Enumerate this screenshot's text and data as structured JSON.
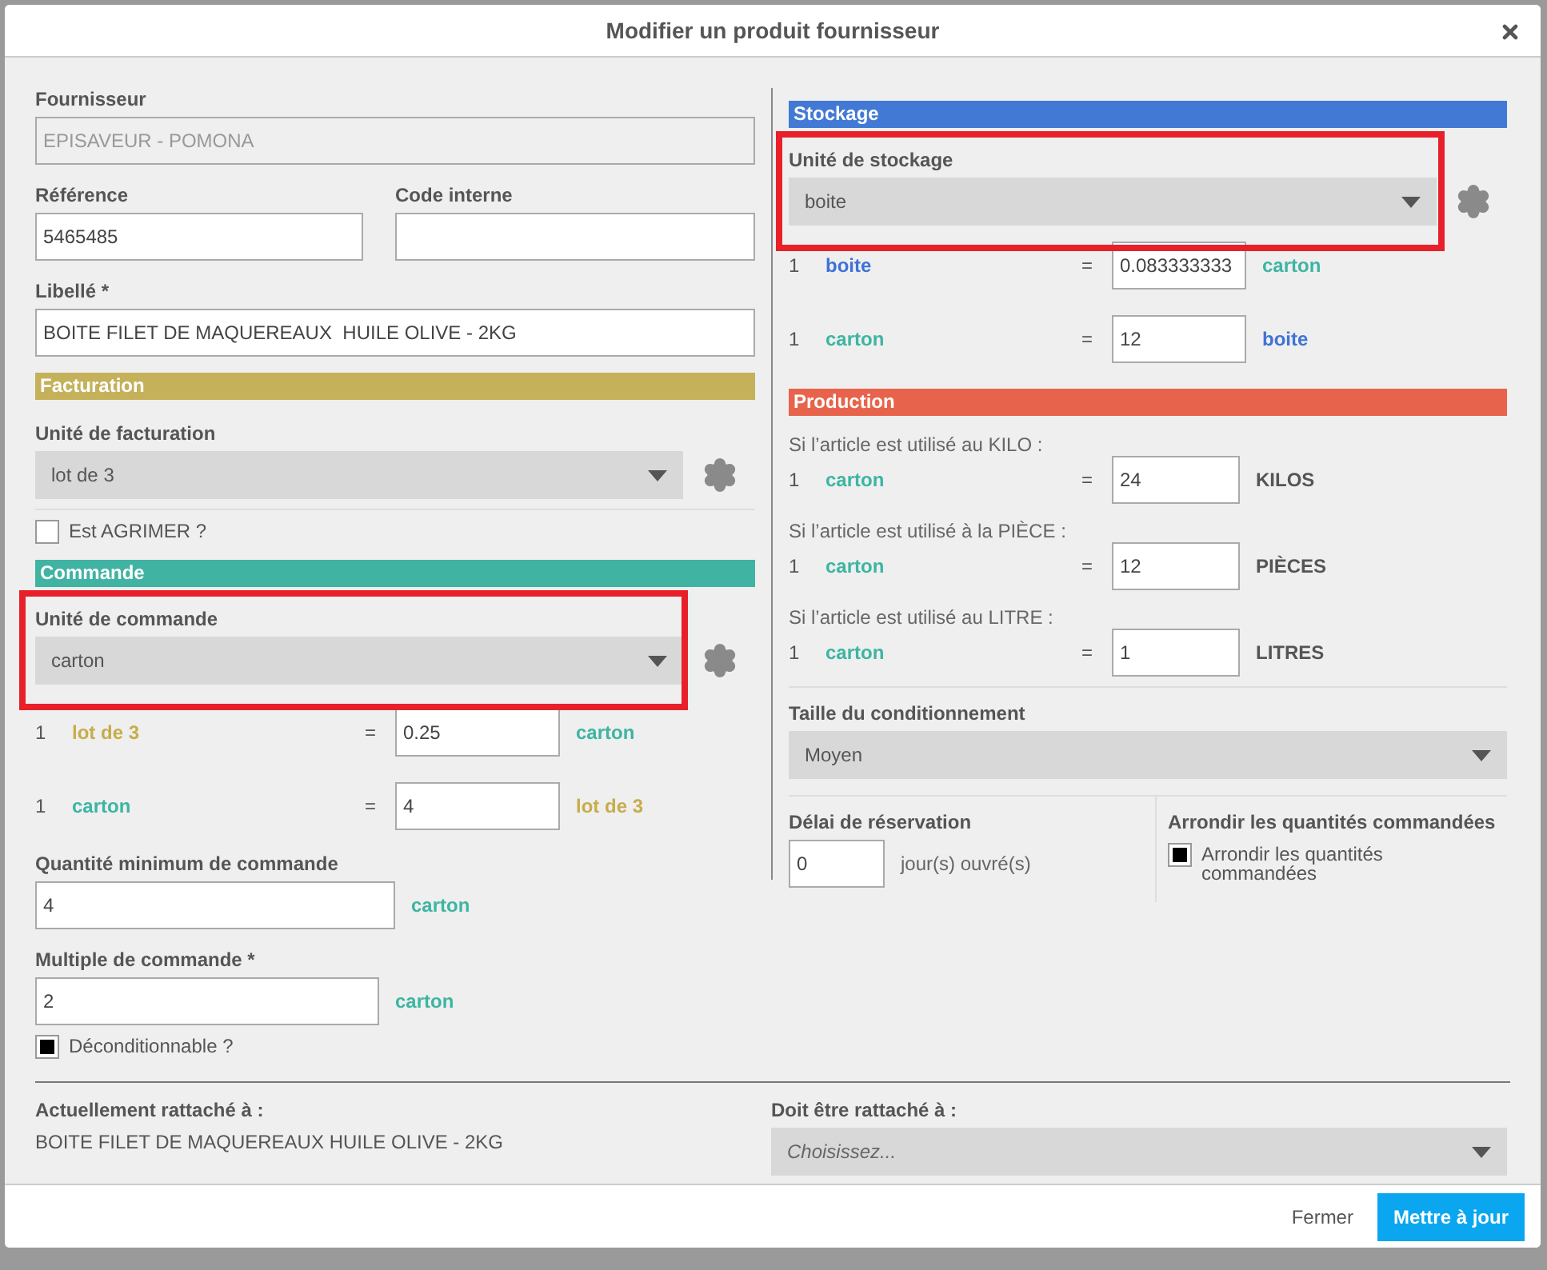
{
  "dialog": {
    "title": "Modifier un produit fournisseur"
  },
  "left": {
    "supplier": {
      "label": "Fournisseur",
      "value": "EPISAVEUR - POMONA",
      "disabled": true
    },
    "reference": {
      "label": "Référence",
      "value": "5465485"
    },
    "internal_code": {
      "label": "Code interne"
    },
    "product_label": {
      "label": "Libellé *",
      "value": "BOITE FILET DE MAQUEREAUX  HUILE OLIVE - 2KG"
    },
    "billing": {
      "heading": "Facturation",
      "color": "#c4b15a",
      "unit_label": "Unité de facturation",
      "unit_value": "lot de 3",
      "agrimer": {
        "label": "Est AGRIMER ?",
        "checked": false
      }
    },
    "order": {
      "heading": "Commande",
      "color": "#41b3a3",
      "unit_label": "Unité de commande",
      "unit_value": "carton",
      "highlighted": true,
      "conversions": [
        {
          "qty": "1",
          "unit": {
            "label": "lot de 3",
            "kind": "billing"
          },
          "eq": "=",
          "value": "0.25",
          "target": {
            "label": "carton",
            "kind": "order"
          }
        },
        {
          "qty": "1",
          "unit": {
            "label": "carton",
            "kind": "order"
          },
          "eq": "=",
          "value": "4",
          "target": {
            "label": "lot de 3",
            "kind": "billing"
          }
        }
      ],
      "min_qty": {
        "label": "Quantité minimum de commande",
        "value": "4",
        "unit": "carton"
      },
      "multiple": {
        "label": "Multiple de commande *",
        "value": "2",
        "unit": "carton"
      },
      "deconditionnable": {
        "label": "Déconditionnable ?",
        "checked": true
      }
    }
  },
  "right": {
    "storage": {
      "heading": "Stockage",
      "color": "#4279d5",
      "unit_label": "Unité de stockage",
      "unit_value": "boite",
      "highlighted": true,
      "conversions": [
        {
          "qty": "1",
          "unit": {
            "label": "boite",
            "kind": "storage"
          },
          "eq": "=",
          "value": "0.083333333",
          "target": {
            "label": "carton",
            "kind": "order"
          }
        },
        {
          "qty": "1",
          "unit": {
            "label": "carton",
            "kind": "order"
          },
          "eq": "=",
          "value": "12",
          "target": {
            "label": "boite",
            "kind": "storage"
          }
        }
      ]
    },
    "production": {
      "heading": "Production",
      "color": "#e8634b",
      "rows": [
        {
          "note": "Si l’article est utilisé au KILO :",
          "qty": "1",
          "unit": {
            "label": "carton",
            "kind": "order"
          },
          "eq": "=",
          "value": "24",
          "target": {
            "label": "KILOS",
            "kind": "plain"
          }
        },
        {
          "note": "Si l’article est utilisé à la PIÈCE :",
          "qty": "1",
          "unit": {
            "label": "carton",
            "kind": "order"
          },
          "eq": "=",
          "value": "12",
          "target": {
            "label": "PIÈCES",
            "kind": "plain"
          }
        },
        {
          "note": "Si l’article est utilisé au LITRE :",
          "qty": "1",
          "unit": {
            "label": "carton",
            "kind": "order"
          },
          "eq": "=",
          "value": "1",
          "target": {
            "label": "LITRES",
            "kind": "plain"
          }
        }
      ]
    },
    "packaging": {
      "label": "Taille du conditionnement",
      "value": "Moyen"
    },
    "reservation": {
      "label": "Délai de réservation",
      "value": "0",
      "suffix": "jour(s) ouvré(s)"
    },
    "rounding": {
      "label": "Arrondir les quantités commandées",
      "checkbox_label": "Arrondir les quantités commandées",
      "checked": true
    }
  },
  "attachment": {
    "current_label": "Actuellement rattaché à :",
    "current_value": "BOITE FILET DE MAQUEREAUX HUILE OLIVE - 2KG",
    "target_label": "Doit être rattaché à :",
    "target_placeholder": "Choisissez..."
  },
  "buttons": [
    {
      "label": "Fermer",
      "kind": "link"
    },
    {
      "label": "Mettre à jour",
      "kind": "primary"
    }
  ]
}
